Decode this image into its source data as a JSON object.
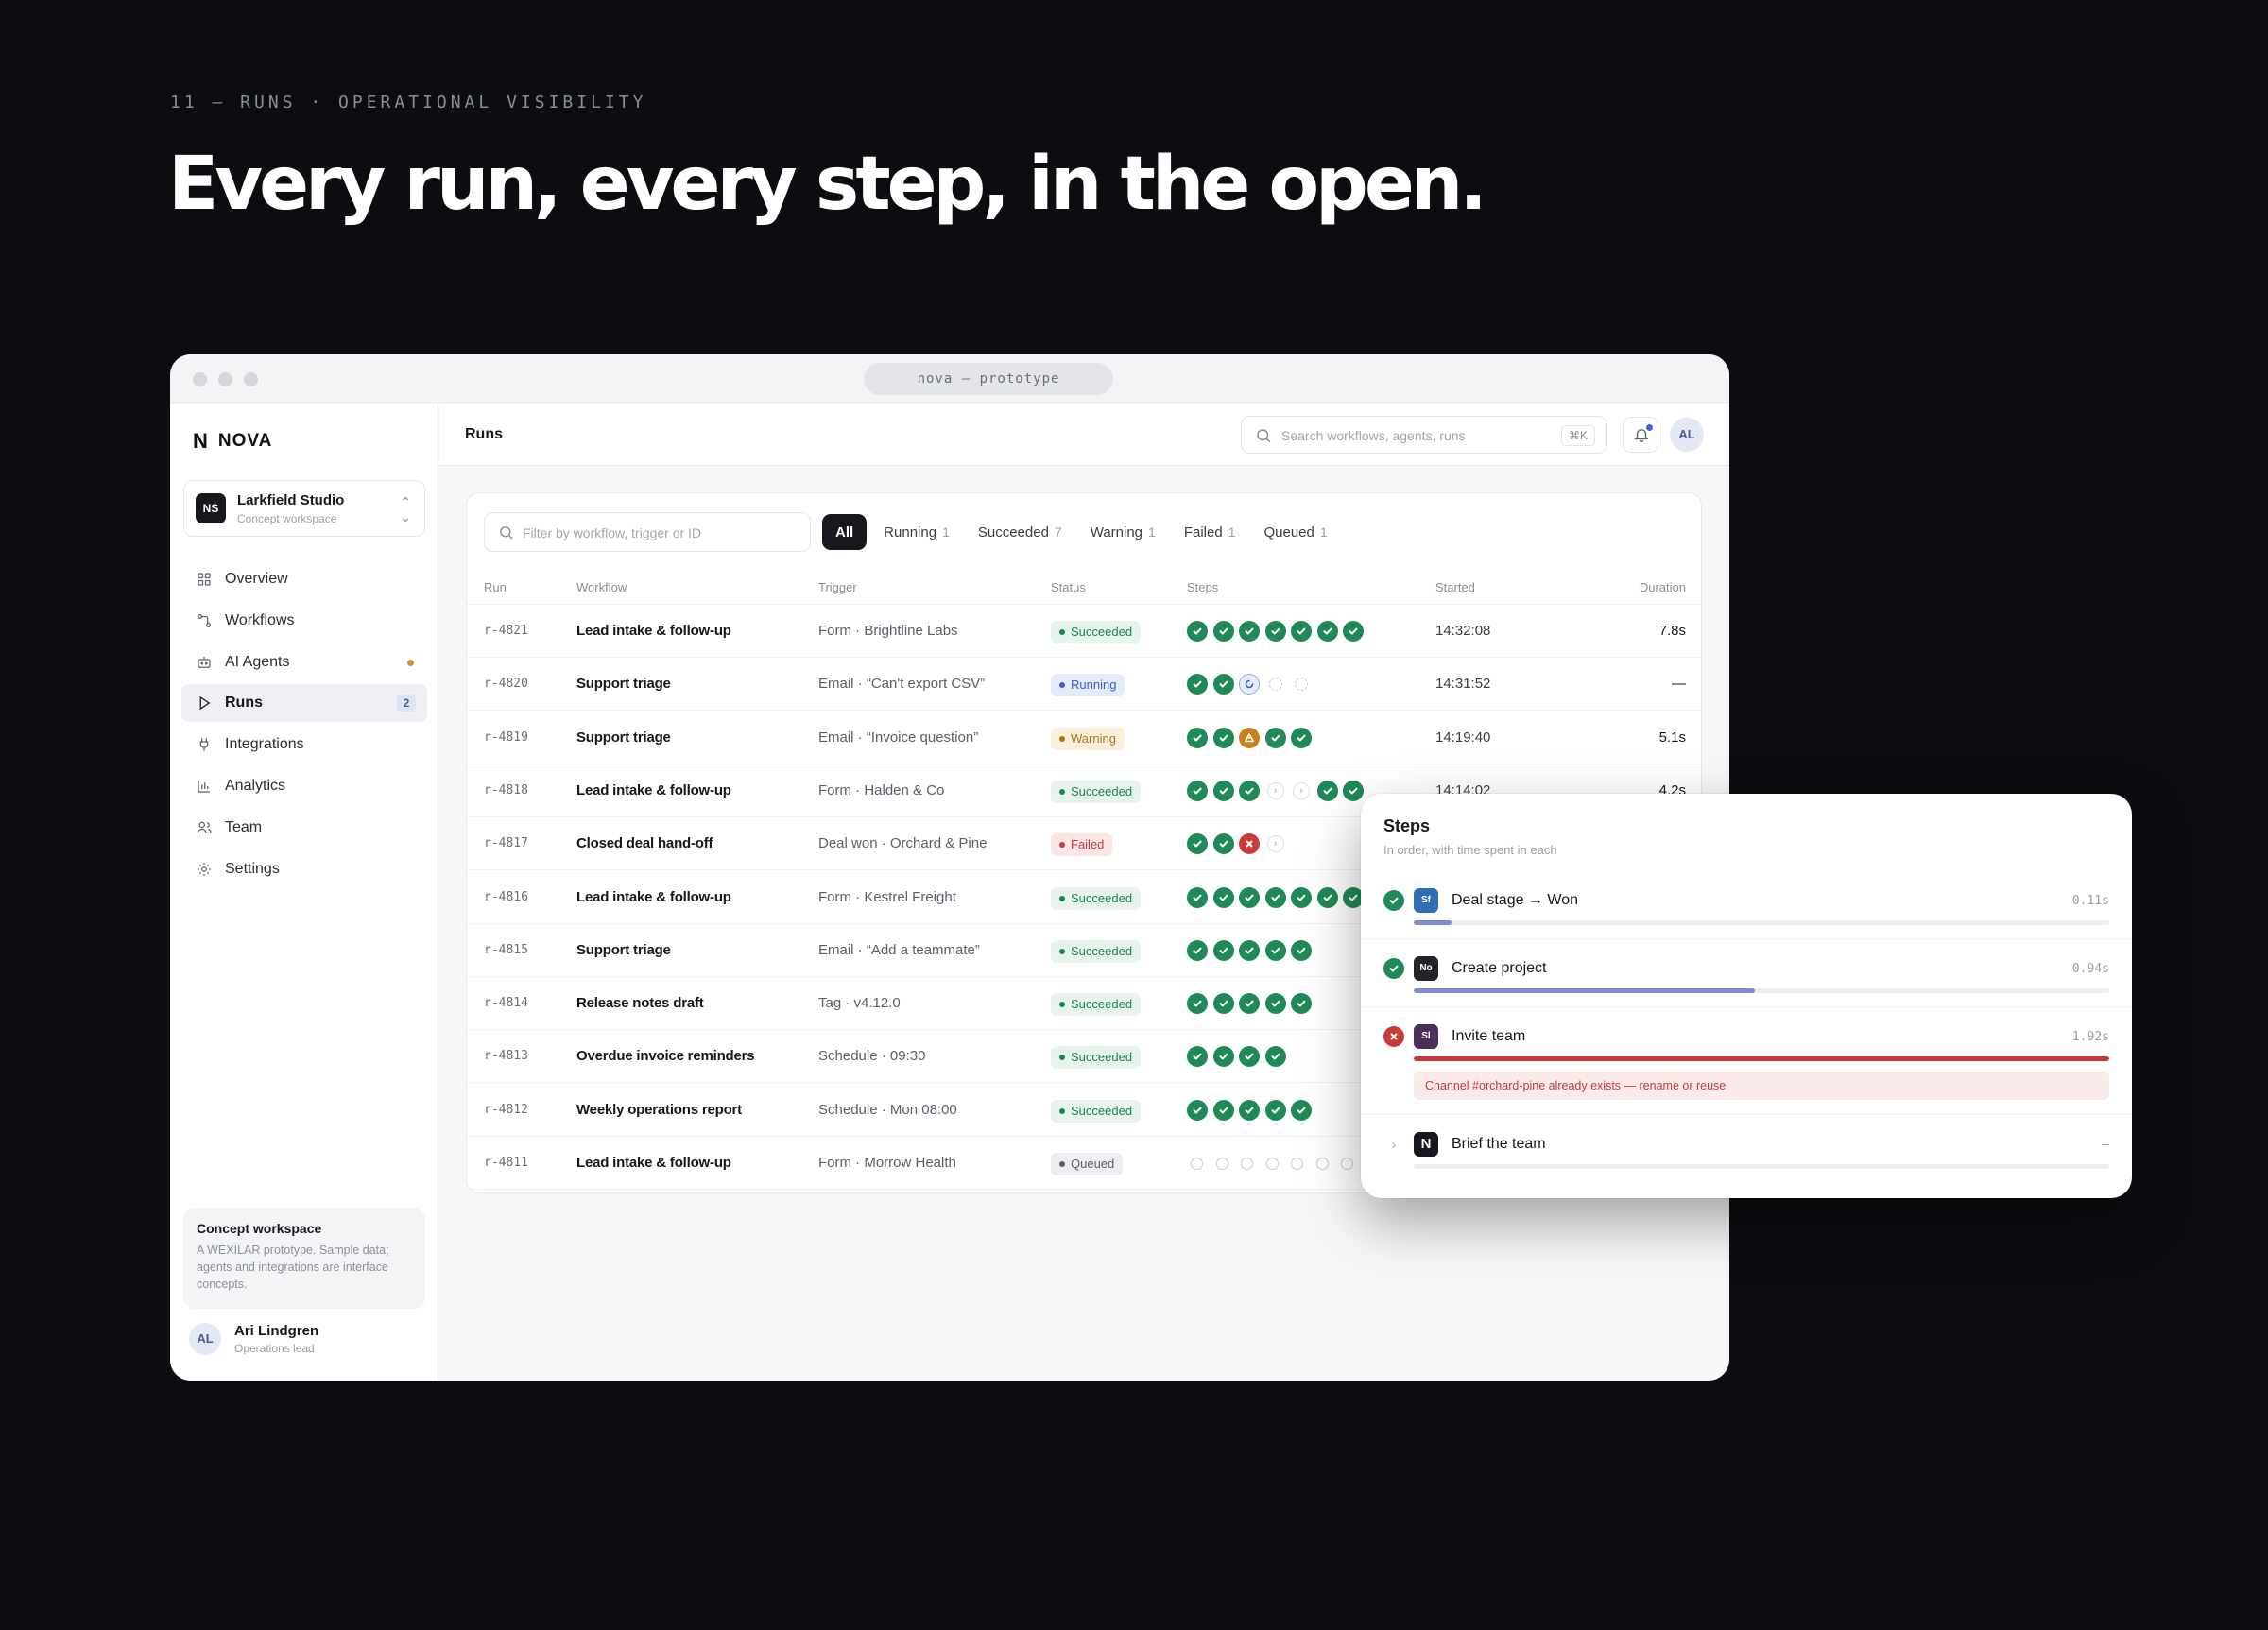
{
  "slide": {
    "eyebrow": "11 — RUNS · OPERATIONAL VISIBILITY",
    "headline": "Every run, every step, in the open."
  },
  "window": {
    "url": "nova — prototype"
  },
  "brand": {
    "name": "NOVA",
    "mark": "N"
  },
  "workspace": {
    "initials": "NS",
    "name": "Larkfield Studio",
    "subtitle": "Concept workspace"
  },
  "nav": [
    {
      "label": "Overview",
      "icon": "grid-icon"
    },
    {
      "label": "Workflows",
      "icon": "workflow-icon"
    },
    {
      "label": "AI Agents",
      "icon": "agent-icon",
      "dot": true
    },
    {
      "label": "Runs",
      "icon": "play-icon",
      "active": true,
      "badge": "2"
    },
    {
      "label": "Integrations",
      "icon": "plug-icon"
    },
    {
      "label": "Analytics",
      "icon": "chart-icon"
    },
    {
      "label": "Team",
      "icon": "team-icon"
    },
    {
      "label": "Settings",
      "icon": "gear-icon"
    }
  ],
  "concept": {
    "title": "Concept workspace",
    "text": "A WEXILAR prototype. Sample data; agents and integrations are interface concepts."
  },
  "user": {
    "initials": "AL",
    "name": "Ari Lindgren",
    "role": "Operations lead"
  },
  "header": {
    "title": "Runs",
    "search_placeholder": "Search workflows, agents, runs",
    "shortcut": "⌘K",
    "avatar": "AL"
  },
  "filter": {
    "placeholder": "Filter by workflow, trigger or ID"
  },
  "tabs": [
    {
      "label": "All",
      "count": "",
      "active": true
    },
    {
      "label": "Running",
      "count": "1"
    },
    {
      "label": "Succeeded",
      "count": "7"
    },
    {
      "label": "Warning",
      "count": "1"
    },
    {
      "label": "Failed",
      "count": "1"
    },
    {
      "label": "Queued",
      "count": "1"
    }
  ],
  "columns": {
    "run": "Run",
    "workflow": "Workflow",
    "trigger": "Trigger",
    "status": "Status",
    "steps": "Steps",
    "started": "Started",
    "duration": "Duration"
  },
  "colors": {
    "success": "#1f8a55",
    "running": "#3c5fbf",
    "warning": "#c9811b",
    "failed": "#c93b3b",
    "progress": "#8189d6",
    "error_bar": "#c93b3b"
  },
  "runs": [
    {
      "id": "r-4821",
      "workflow": "Lead intake & follow-up",
      "trigger": "Form · Brightline Labs",
      "status": "Succeeded",
      "steps": [
        "done",
        "done",
        "done",
        "done",
        "done",
        "done",
        "done"
      ],
      "started": "14:32:08",
      "duration": "7.8s"
    },
    {
      "id": "r-4820",
      "workflow": "Support triage",
      "trigger": "Email · “Can't export CSV”",
      "status": "Running",
      "steps": [
        "done",
        "done",
        "run",
        "pending",
        "pending"
      ],
      "started": "14:31:52",
      "duration": "—"
    },
    {
      "id": "r-4819",
      "workflow": "Support triage",
      "trigger": "Email · “Invoice question”",
      "status": "Warning",
      "steps": [
        "done",
        "done",
        "warn",
        "done",
        "done"
      ],
      "started": "14:19:40",
      "duration": "5.1s"
    },
    {
      "id": "r-4818",
      "workflow": "Lead intake & follow-up",
      "trigger": "Form · Halden & Co",
      "status": "Succeeded",
      "steps": [
        "done",
        "done",
        "done",
        "skip",
        "skip",
        "done",
        "done"
      ],
      "started": "14:14:02",
      "duration": "4.2s"
    },
    {
      "id": "r-4817",
      "workflow": "Closed deal hand-off",
      "trigger": "Deal won · Orchard & Pine",
      "status": "Failed",
      "steps": [
        "done",
        "done",
        "fail",
        "skip"
      ],
      "started": "",
      "duration": ""
    },
    {
      "id": "r-4816",
      "workflow": "Lead intake & follow-up",
      "trigger": "Form · Kestrel Freight",
      "status": "Succeeded",
      "steps": [
        "done",
        "done",
        "done",
        "done",
        "done",
        "done",
        "done"
      ],
      "started": "",
      "duration": ""
    },
    {
      "id": "r-4815",
      "workflow": "Support triage",
      "trigger": "Email · “Add a teammate”",
      "status": "Succeeded",
      "steps": [
        "done",
        "done",
        "done",
        "done",
        "done"
      ],
      "started": "",
      "duration": ""
    },
    {
      "id": "r-4814",
      "workflow": "Release notes draft",
      "trigger": "Tag · v4.12.0",
      "status": "Succeeded",
      "steps": [
        "done",
        "done",
        "done",
        "done",
        "done"
      ],
      "started": "",
      "duration": ""
    },
    {
      "id": "r-4813",
      "workflow": "Overdue invoice reminders",
      "trigger": "Schedule · 09:30",
      "status": "Succeeded",
      "steps": [
        "done",
        "done",
        "done",
        "done"
      ],
      "started": "",
      "duration": ""
    },
    {
      "id": "r-4812",
      "workflow": "Weekly operations report",
      "trigger": "Schedule · Mon 08:00",
      "status": "Succeeded",
      "steps": [
        "done",
        "done",
        "done",
        "done",
        "done"
      ],
      "started": "",
      "duration": ""
    },
    {
      "id": "r-4811",
      "workflow": "Lead intake & follow-up",
      "trigger": "Form · Morrow Health",
      "status": "Queued",
      "steps": [
        "queued",
        "queued",
        "queued",
        "queued",
        "queued",
        "queued",
        "queued"
      ],
      "started": "",
      "duration": ""
    }
  ],
  "steps_panel": {
    "title": "Steps",
    "subtitle": "In order, with time spent in each",
    "steps": [
      {
        "status": "done",
        "app": "Sf",
        "app_color": "#2f6db5",
        "name": "Deal stage → Won",
        "time": "0.11s",
        "progress": 0.055,
        "bar_color": "#8189d6"
      },
      {
        "status": "done",
        "app": "No",
        "app_color": "#222428",
        "name": "Create project",
        "time": "0.94s",
        "progress": 0.49,
        "bar_color": "#8189d6"
      },
      {
        "status": "fail",
        "app": "Sl",
        "app_color": "#4a2f5a",
        "name": "Invite team",
        "time": "1.92s",
        "progress": 1.0,
        "bar_color": "#c93b3b",
        "error": "Channel #orchard-pine already exists — rename or reuse"
      },
      {
        "status": "pending",
        "app": "N",
        "app_color": "#16181d",
        "name": "Brief the team",
        "time": "—",
        "progress": 0,
        "bar_color": "#8189d6"
      }
    ]
  }
}
